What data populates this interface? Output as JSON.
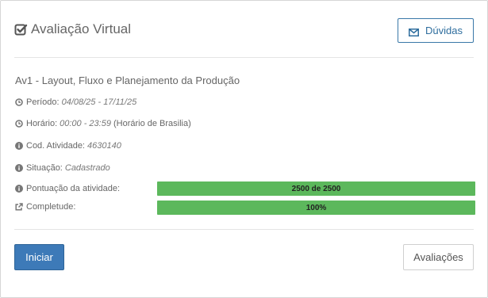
{
  "header": {
    "title": "Avaliação Virtual",
    "title_icon": "check-square-icon",
    "help_button": {
      "label": "Dúvidas",
      "icon": "envelope-icon"
    }
  },
  "activity": {
    "title": "Av1 - Layout, Fluxo e Planejamento da Produção",
    "fields": {
      "periodo": {
        "label": "Período:",
        "value": "04/08/25 - 17/11/25",
        "icon": "clock-icon"
      },
      "horario": {
        "label": "Horário:",
        "value": "00:00 - 23:59",
        "extra": "(Horário de Brasilia)",
        "icon": "clock-icon"
      },
      "codigo": {
        "label": "Cod. Atividade:",
        "value": "4630140",
        "icon": "info-icon"
      },
      "situacao": {
        "label": "Situação:",
        "value": "Cadastrado",
        "icon": "info-icon"
      },
      "pontuacao": {
        "label": "Pontuação da atividade:",
        "bar_label": "2500 de 2500",
        "progress": 1.0,
        "icon": "info-icon"
      },
      "completude": {
        "label": "Completude:",
        "bar_label": "100%",
        "progress": 1.0,
        "icon": "external-link-icon"
      }
    }
  },
  "actions": {
    "start_label": "Iniciar",
    "evaluations_label": "Avaliações"
  },
  "colors": {
    "primary": "#3d7ab8",
    "progress": "#5cb85c",
    "border": "#d6d6d6"
  }
}
